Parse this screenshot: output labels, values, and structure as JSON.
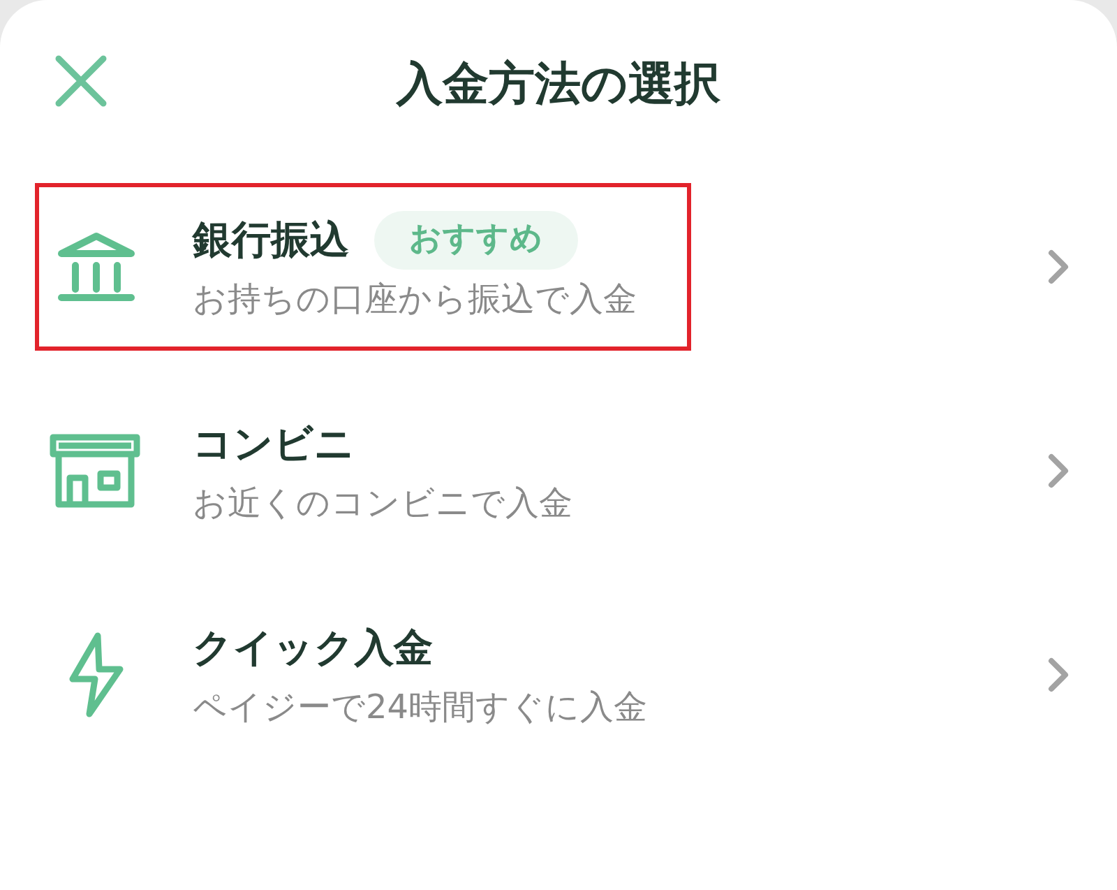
{
  "header": {
    "title": "入金方法の選択"
  },
  "methods": [
    {
      "kind": "bank",
      "title": "銀行振込",
      "badge": "おすすめ",
      "description": "お持ちの口座から振込で入金",
      "highlighted": true
    },
    {
      "kind": "store",
      "title": "コンビニ",
      "description": "お近くのコンビニで入金",
      "highlighted": false
    },
    {
      "kind": "quick",
      "title": "クイック入金",
      "description": "ペイジーで24時間すぐに入金",
      "highlighted": false
    }
  ]
}
